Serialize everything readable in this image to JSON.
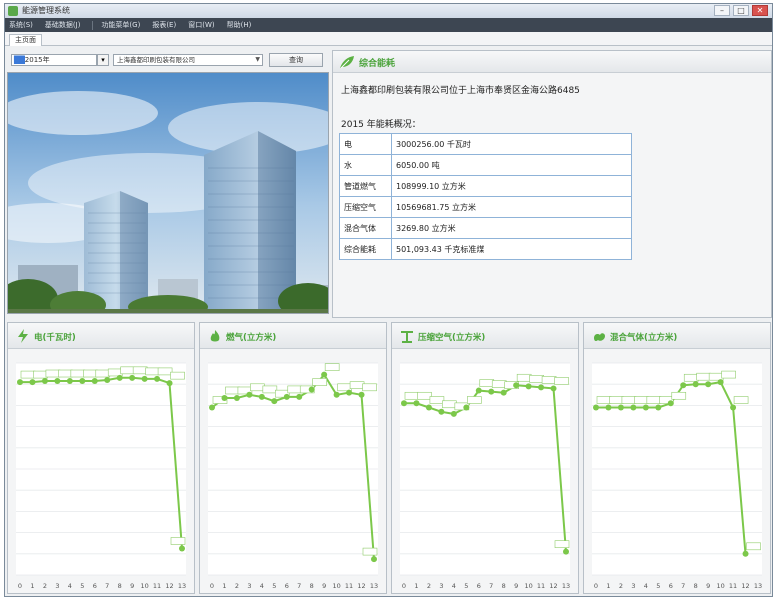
{
  "window": {
    "title": "能源管理系统",
    "buttons": [
      "–",
      "□",
      "✕"
    ]
  },
  "menubar": {
    "items": [
      "系统(S)",
      "基础数据(J)",
      "功能菜单(G)",
      "报表(E)",
      "窗口(W)",
      "帮助(H)"
    ]
  },
  "tabs": [
    {
      "label": "主页面"
    }
  ],
  "toolbar": {
    "date_value": "2015年",
    "date_suffix": "▾",
    "company": "上海鑫都印刷包装有限公司",
    "query_label": "查询"
  },
  "overview": {
    "title": "综合能耗",
    "address": "上海鑫都印刷包装有限公司位于上海市奉贤区金海公路6485",
    "year_heading": "2015  年能耗概况：",
    "rows": [
      {
        "name": "电",
        "value": "3000256.00 千瓦时"
      },
      {
        "name": "水",
        "value": "6050.00 吨"
      },
      {
        "name": "管道燃气",
        "value": "108999.10 立方米"
      },
      {
        "name": "压缩空气",
        "value": "10569681.75 立方米"
      },
      {
        "name": "混合气体",
        "value": "3269.80 立方米"
      },
      {
        "name": "综合能耗",
        "value": "501,093.43 千克标准煤"
      }
    ]
  },
  "chart_data": [
    {
      "type": "line",
      "title": "电(千瓦时)",
      "icon": "lightning-icon",
      "color": "#7cc84a",
      "x": [
        "0",
        "1",
        "2",
        "3",
        "4",
        "5",
        "6",
        "7",
        "8",
        "9",
        "10",
        "11",
        "12",
        "13"
      ],
      "values": [
        3.2,
        3.2,
        3.3,
        3.3,
        3.3,
        3.3,
        3.3,
        3.4,
        3.6,
        3.6,
        3.5,
        3.5,
        3.1,
        -12.5
      ],
      "ylim": [
        -15,
        5
      ]
    },
    {
      "type": "line",
      "title": "燃气(立方米)",
      "icon": "flame-icon",
      "color": "#7cc84a",
      "x": [
        "0",
        "1",
        "2",
        "3",
        "4",
        "5",
        "6",
        "7",
        "8",
        "9",
        "10",
        "11",
        "12",
        "13"
      ],
      "values": [
        0.8,
        1.7,
        1.7,
        2.0,
        1.8,
        1.4,
        1.8,
        1.8,
        2.5,
        3.9,
        2.0,
        2.2,
        2.0,
        -13.5
      ],
      "ylim": [
        -15,
        5
      ]
    },
    {
      "type": "line",
      "title": "压缩空气(立方米)",
      "icon": "pipe-icon",
      "color": "#7cc84a",
      "x": [
        "0",
        "1",
        "2",
        "3",
        "4",
        "5",
        "6",
        "7",
        "8",
        "9",
        "10",
        "11",
        "12",
        "13"
      ],
      "values": [
        1.2,
        1.2,
        0.8,
        0.4,
        0.2,
        0.8,
        2.4,
        2.3,
        2.2,
        2.9,
        2.8,
        2.7,
        2.6,
        -12.8
      ],
      "ylim": [
        -15,
        5
      ]
    },
    {
      "type": "line",
      "title": "混合气体(立方米)",
      "icon": "gas-icon",
      "color": "#7cc84a",
      "x": [
        "0",
        "1",
        "2",
        "3",
        "4",
        "5",
        "6",
        "7",
        "8",
        "9",
        "10",
        "11",
        "12",
        "13"
      ],
      "values": [
        0.8,
        0.8,
        0.8,
        0.8,
        0.8,
        0.8,
        1.2,
        2.9,
        3.0,
        3.0,
        3.2,
        0.8,
        -13.0
      ],
      "ylim": [
        -15,
        5
      ]
    }
  ]
}
